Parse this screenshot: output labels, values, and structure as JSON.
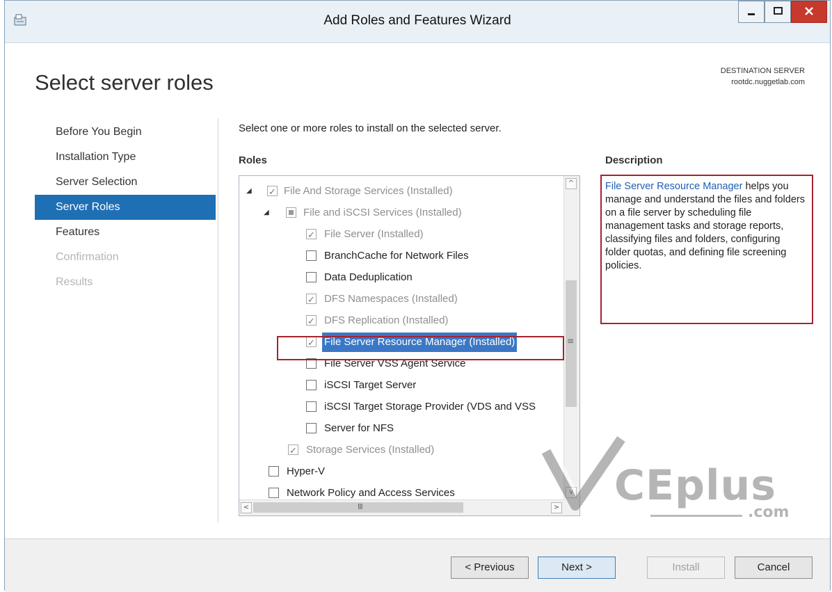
{
  "window": {
    "title": "Add Roles and Features Wizard",
    "controls": {
      "minimize": "minimize",
      "maximize": "maximize",
      "close": "x"
    }
  },
  "page": {
    "title": "Select server roles",
    "destination_label": "DESTINATION SERVER",
    "destination_value": "rootdc.nuggetlab.com"
  },
  "nav": {
    "items": [
      {
        "label": "Before You Begin",
        "state": "normal"
      },
      {
        "label": "Installation Type",
        "state": "normal"
      },
      {
        "label": "Server Selection",
        "state": "normal"
      },
      {
        "label": "Server Roles",
        "state": "selected"
      },
      {
        "label": "Features",
        "state": "normal"
      },
      {
        "label": "Confirmation",
        "state": "disabled"
      },
      {
        "label": "Results",
        "state": "disabled"
      }
    ]
  },
  "main": {
    "intro": "Select one or more roles to install on the selected server.",
    "roles_label": "Roles",
    "description_label": "Description",
    "roles": [
      {
        "label": "File And Storage Services (Installed)",
        "checked": true,
        "installed": true,
        "expanded": true
      },
      {
        "label": "File and iSCSI Services (Installed)",
        "checked": "partial",
        "installed": true,
        "expanded": true
      },
      {
        "label": "File Server (Installed)",
        "checked": true,
        "installed": true
      },
      {
        "label": "BranchCache for Network Files",
        "checked": false,
        "installed": false
      },
      {
        "label": "Data Deduplication",
        "checked": false,
        "installed": false
      },
      {
        "label": "DFS Namespaces (Installed)",
        "checked": true,
        "installed": true
      },
      {
        "label": "DFS Replication (Installed)",
        "checked": true,
        "installed": true
      },
      {
        "label": "File Server Resource Manager (Installed)",
        "checked": true,
        "installed": true,
        "selected": true
      },
      {
        "label": "File Server VSS Agent Service",
        "checked": false,
        "installed": false
      },
      {
        "label": "iSCSI Target Server",
        "checked": false,
        "installed": false
      },
      {
        "label": "iSCSI Target Storage Provider (VDS and VSS",
        "checked": false,
        "installed": false
      },
      {
        "label": "Server for NFS",
        "checked": false,
        "installed": false
      },
      {
        "label": "Storage Services (Installed)",
        "checked": true,
        "installed": true
      },
      {
        "label": "Hyper-V",
        "checked": false,
        "installed": false
      },
      {
        "label": "Network Policy and Access Services",
        "checked": false,
        "installed": false
      }
    ],
    "description": {
      "link": "File Server Resource Manager",
      "text": " helps you manage and understand the files and folders on a file server by scheduling file management tasks and storage reports, classifying files and folders, configuring folder quotas, and defining file screening policies."
    },
    "scrollbar": {
      "up": "^",
      "down": "v",
      "left": "<",
      "right": ">",
      "grip": "≡",
      "hgrip": "III"
    }
  },
  "watermark": {
    "text": "CEplus",
    "suffix": ".com"
  },
  "footer": {
    "previous": "< Previous",
    "next": "Next >",
    "install": "Install",
    "cancel": "Cancel"
  },
  "colors": {
    "accent": "#1f6fb5",
    "highlight_border": "#a8212d",
    "link": "#1f5fb5"
  }
}
